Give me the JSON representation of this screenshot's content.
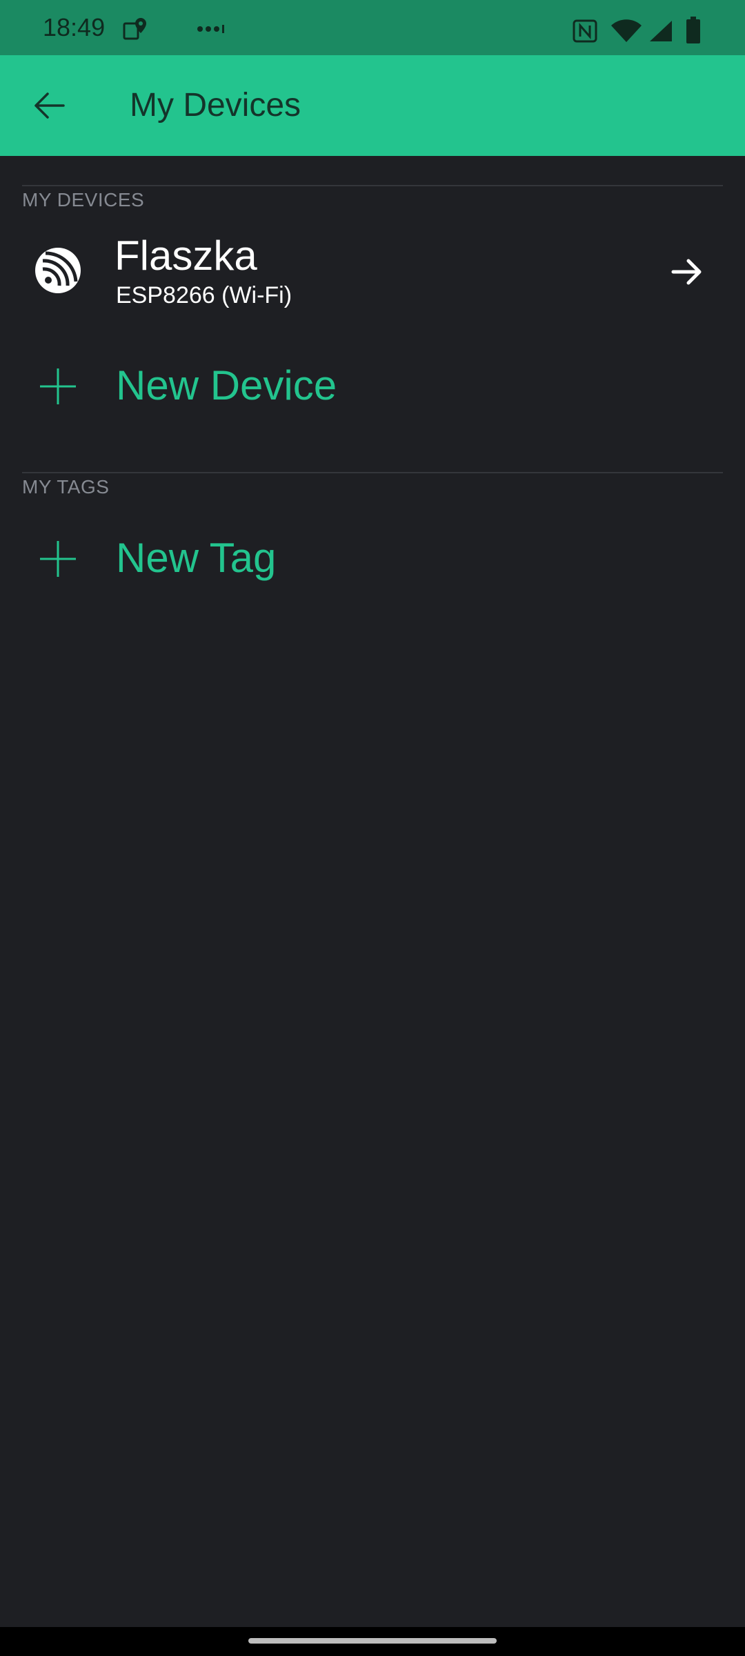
{
  "status_bar": {
    "time": "18:49",
    "icons": [
      "maps-notification-icon",
      "more-notifications-icon",
      "nfc-icon",
      "wifi-icon",
      "cellular-signal-icon",
      "battery-icon"
    ]
  },
  "app_bar": {
    "title": "My Devices",
    "back_icon": "back-arrow-icon"
  },
  "sections": {
    "devices": {
      "header": "MY DEVICES",
      "items": [
        {
          "name": "Flaszka",
          "type": "ESP8266 (Wi-Fi)",
          "icon": "espressif-icon",
          "action_icon": "arrow-right-icon"
        }
      ],
      "add_label": "New Device"
    },
    "tags": {
      "header": "MY TAGS",
      "add_label": "New Tag"
    }
  },
  "colors": {
    "accent": "#23c48e",
    "status_bar": "#1b8a62",
    "background": "#1e1f23",
    "text_primary": "#ffffff",
    "section_header": "#868a92"
  }
}
